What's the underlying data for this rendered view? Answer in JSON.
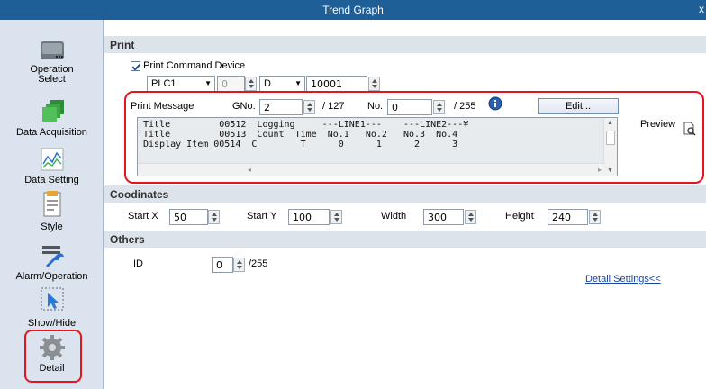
{
  "window": {
    "title": "Trend Graph",
    "close": "x"
  },
  "sidebar": {
    "items": [
      {
        "label": "Operation\nSelect"
      },
      {
        "label": "Data Acquisition"
      },
      {
        "label": "Data Setting"
      },
      {
        "label": "Style"
      },
      {
        "label": "Alarm/Operation"
      },
      {
        "label": "Show/Hide"
      },
      {
        "label": "Detail"
      }
    ]
  },
  "print": {
    "header": "Print",
    "command_device_label": "Print Command Device",
    "plc": "PLC1",
    "station": "0",
    "device_type": "D",
    "device_address": "10001",
    "message_label": "Print Message",
    "gno_label": "GNo.",
    "gno_value": "2",
    "gno_max": "/ 127",
    "no_label": "No.",
    "no_value": "0",
    "no_max": "/ 255",
    "edit_button": "Edit...",
    "preview_label": "Preview",
    "message_lines": [
      "Title         00512  Logging     ---LINE1---    ---LINE2---¥",
      "Title         00513  Count  Time  No.1   No.2   No.3  No.4",
      "Display Item 00514  C        T      0      1      2      3"
    ]
  },
  "coordinates": {
    "header": "Coodinates",
    "start_x_label": "Start X",
    "start_x": "50",
    "start_y_label": "Start Y",
    "start_y": "100",
    "width_label": "Width",
    "width": "300",
    "height_label": "Height",
    "height": "240"
  },
  "others": {
    "header": "Others",
    "id_label": "ID",
    "id_value": "0",
    "id_max": "/255",
    "detail_link": "Detail Settings<<"
  }
}
